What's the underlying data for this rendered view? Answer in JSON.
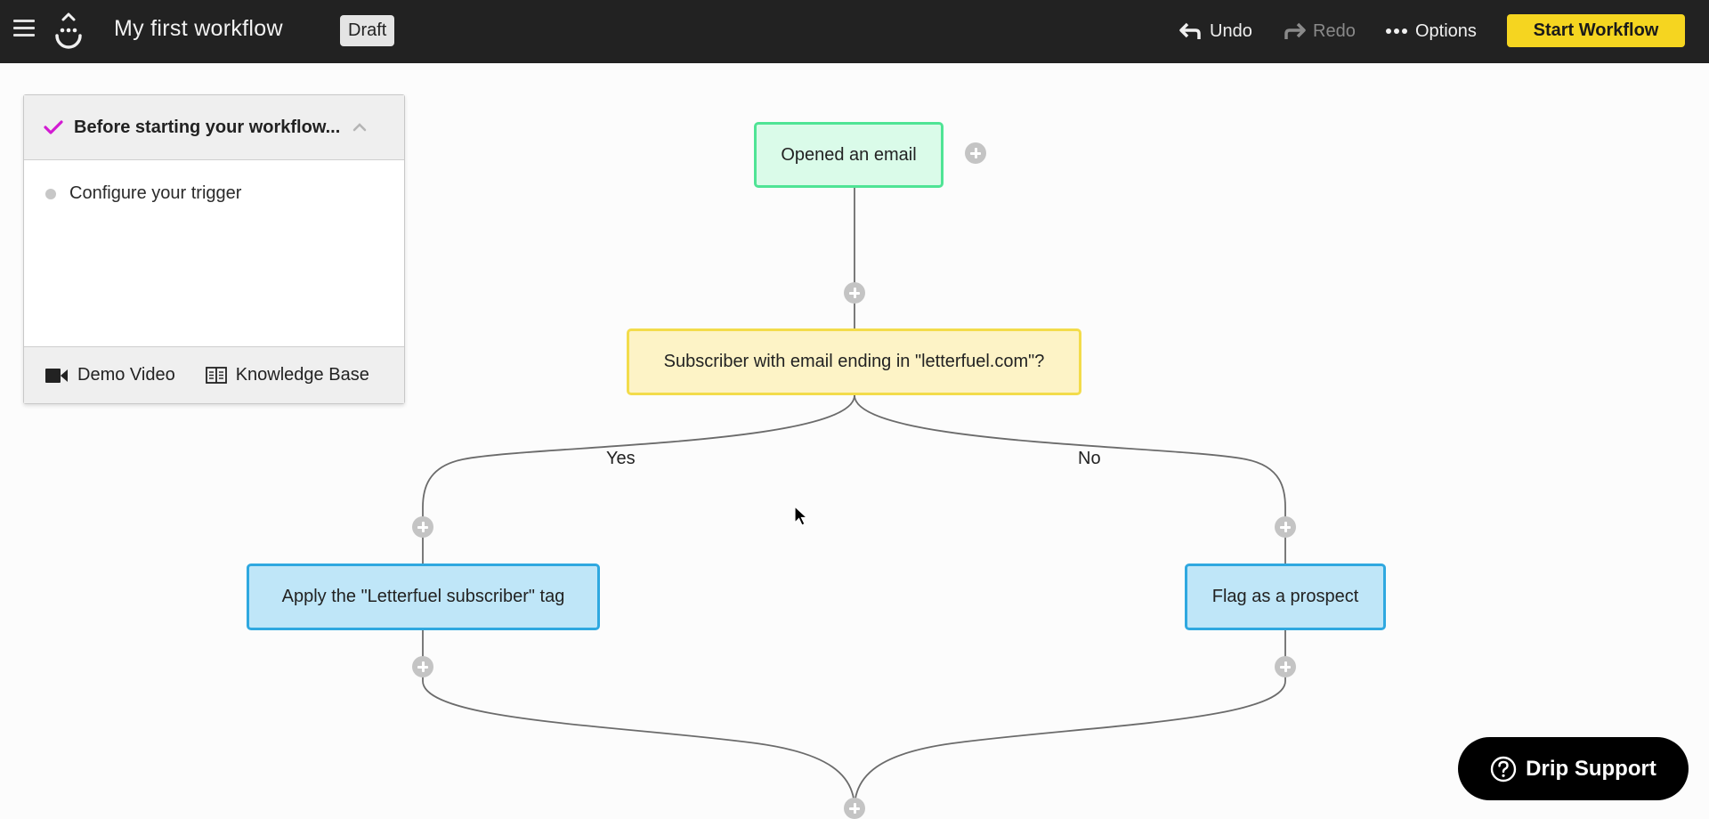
{
  "topbar": {
    "menu_icon": "hamburger-icon",
    "logo_icon": "drip-logo-icon",
    "workflow_title": "My first workflow",
    "status_badge": "Draft",
    "undo_label": "Undo",
    "redo_label": "Redo",
    "options_label": "Options",
    "start_label": "Start Workflow",
    "accent_color": "#f5d520"
  },
  "checklist": {
    "title": "Before starting your workflow...",
    "check_color": "#d21bd2",
    "tasks": [
      {
        "label": "Configure your trigger"
      }
    ],
    "footer_links": [
      {
        "label": "Demo Video",
        "icon": "video-camera-icon"
      },
      {
        "label": "Knowledge Base",
        "icon": "book-icon"
      }
    ]
  },
  "workflow": {
    "trigger": {
      "label": "Opened an email",
      "type": "trigger"
    },
    "decision": {
      "label": "Subscriber with email ending in \"letterfuel.com\"?",
      "type": "decision"
    },
    "branches": {
      "yes": {
        "label": "Yes",
        "action": "Apply the \"Letterfuel subscriber\" tag"
      },
      "no": {
        "label": "No",
        "action": "Flag as a prospect"
      }
    },
    "colors": {
      "trigger_fill": "#dafbe9",
      "trigger_border": "#4fe495",
      "decision_fill": "#fdf3c6",
      "decision_border": "#f3dc4b",
      "action_fill": "#bfe6f8",
      "action_border": "#2fa8e0"
    }
  },
  "support": {
    "label": "Drip Support",
    "icon": "help-circle-icon"
  }
}
